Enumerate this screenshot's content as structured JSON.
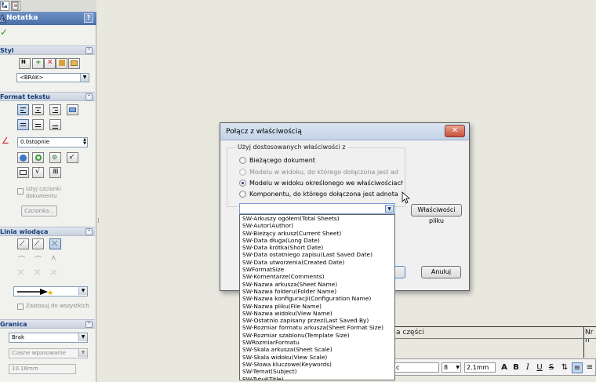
{
  "property_manager": {
    "title": "Notatka",
    "help": "?",
    "styl": {
      "heading": "Styl",
      "style_select": "<BRAK>"
    },
    "format": {
      "heading": "Format tekstu",
      "angle_value": "0.0stopnie",
      "use_doc_font_label": "Użyj czcionki dokumentu",
      "font_button": "Czcionka..."
    },
    "leader": {
      "heading": "Linia wiodąca",
      "apply_all_label": "Zastosuj do wszystkich"
    },
    "border": {
      "heading": "Granica",
      "style_select": "Brak",
      "size_select": "Ciasne wpasowanie",
      "size_value": "10.16mm"
    }
  },
  "canvas": {
    "cell_label_1": "a części",
    "cell_label_2": "Nr n",
    "format_bar": {
      "font_name": "c",
      "font_size": "8",
      "height": "2.1mm",
      "bold": "B",
      "italic": "I",
      "underline": "U",
      "strikethrough": "S"
    }
  },
  "dialog": {
    "title": "Połącz z właściwością",
    "close": "✕",
    "group_label": "Użyj dostosowanych właściwości z",
    "options": [
      {
        "label": "Bieżącego dokument",
        "checked": false,
        "enabled": true
      },
      {
        "label": "Modelu w widoku, do którego dołączona jest adnot",
        "checked": false,
        "enabled": false
      },
      {
        "label": "Modelu w widoku określonego we właściwościach ark",
        "checked": true,
        "enabled": true
      },
      {
        "label": "Komponentu, do którego dołączona jest adnota",
        "checked": false,
        "enabled": true
      }
    ],
    "file_properties_button": "Właściwości pliku",
    "cancel_button": "Anuluj",
    "dropdown_items": [
      "SW-Arkuszy ogółem(Total Sheets)",
      "SW-Autor(Author)",
      "SW-Bieżący arkusz(Current Sheet)",
      "SW-Data długa(Long Date)",
      "SW-Data krótka(Short Date)",
      "SW-Data ostatniego zapisu(Last Saved Date)",
      "SW-Data utworzenia(Created Date)",
      "SWFormatSize",
      "SW-Komentarze(Comments)",
      "SW-Nazwa arkusza(Sheet Name)",
      "SW-Nazwa folderu(Folder Name)",
      "SW-Nazwa konfiguracji(Configuration Name)",
      "SW-Nazwa pliku(File Name)",
      "SW-Nazwa widoku(View Name)",
      "SW-Ostatnio zapisany przez(Last Saved By)",
      "SW-Rozmiar formatu arkusza(Sheet Format Size)",
      "SW-Rozmiar szablonu(Template Size)",
      "SWRozmiarFormatu",
      "SW-Skala arkusza(Sheet Scale)",
      "SW-Skala widoku(View Scale)",
      "SW-Słowa kluczowe(Keywords)",
      "SW-Temat(Subject)",
      "SW-Tytuł(Title)"
    ]
  },
  "colors": {
    "title_bar": "#4a6fa8",
    "section_heading_text": "#143d7a",
    "canvas_bg": "#e9e8df",
    "dialog_bg": "#f0f0f0",
    "close_button": "#c75038"
  }
}
